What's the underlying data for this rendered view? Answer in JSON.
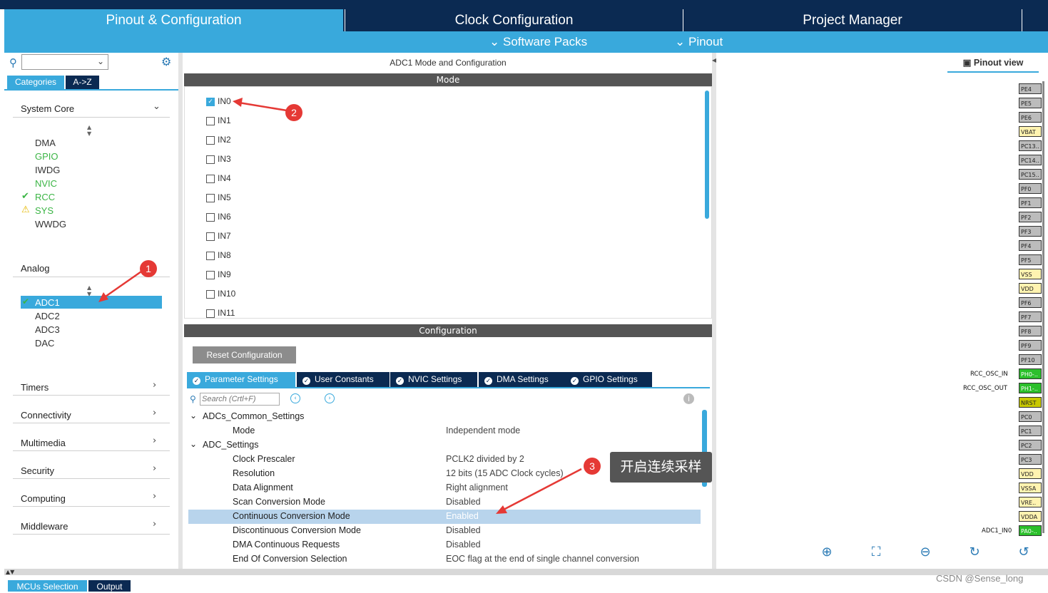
{
  "tabs": [
    {
      "label": "Pinout & Configuration"
    },
    {
      "label": "Clock Configuration"
    },
    {
      "label": "Project Manager"
    }
  ],
  "subbar": {
    "software_packs": "Software Packs",
    "pinout": "Pinout"
  },
  "left": {
    "tab_categories": "Categories",
    "tab_az": "A->Z",
    "system_core": "System Core",
    "system_core_items": [
      "DMA",
      "GPIO",
      "IWDG",
      "NVIC",
      "RCC",
      "SYS",
      "WWDG"
    ],
    "analog": "Analog",
    "analog_items": [
      "ADC1",
      "ADC2",
      "ADC3",
      "DAC"
    ],
    "categories": [
      "Timers",
      "Connectivity",
      "Multimedia",
      "Security",
      "Computing",
      "Middleware"
    ]
  },
  "center": {
    "title": "ADC1 Mode and Configuration",
    "mode_header": "Mode",
    "channels": [
      "IN0",
      "IN1",
      "IN2",
      "IN3",
      "IN4",
      "IN5",
      "IN6",
      "IN7",
      "IN8",
      "IN9",
      "IN10",
      "IN11"
    ],
    "config_header": "Configuration",
    "reset_button": "Reset Configuration",
    "param_tabs": [
      "Parameter Settings",
      "User Constants",
      "NVIC Settings",
      "DMA Settings",
      "GPIO Settings"
    ],
    "search_placeholder": "Search (Crtl+F)",
    "groups": {
      "common": "ADCs_Common_Settings",
      "adc": "ADC_Settings"
    },
    "params": [
      {
        "name": "Mode",
        "value": "Independent mode"
      },
      {
        "name": "Clock Prescaler",
        "value": "PCLK2 divided by 2"
      },
      {
        "name": "Resolution",
        "value": "12 bits (15 ADC Clock cycles)"
      },
      {
        "name": "Data Alignment",
        "value": "Right alignment"
      },
      {
        "name": "Scan Conversion Mode",
        "value": "Disabled"
      },
      {
        "name": "Continuous Conversion Mode",
        "value": "Enabled"
      },
      {
        "name": "Discontinuous Conversion Mode",
        "value": "Disabled"
      },
      {
        "name": "DMA Continuous Requests",
        "value": "Disabled"
      },
      {
        "name": "End Of Conversion Selection",
        "value": "EOC flag at the end of single channel conversion"
      }
    ]
  },
  "right": {
    "pinout_view": "Pinout view",
    "pins": [
      "PE4",
      "PE5",
      "PE6",
      "VBAT",
      "PC13..",
      "PC14..",
      "PC15..",
      "PF0",
      "PF1",
      "PF2",
      "PF3",
      "PF4",
      "PF5",
      "VSS",
      "VDD",
      "PF6",
      "PF7",
      "PF8",
      "PF9",
      "PF10",
      "PH0-..",
      "PH1-..",
      "NRST",
      "PC0",
      "PC1",
      "PC2",
      "PC3",
      "VDD",
      "VSSA",
      "VRE..",
      "VDDA",
      "PA0-.."
    ],
    "pin_label_osc_in": "RCC_OSC_IN",
    "pin_label_osc_out": "RCC_OSC_OUT",
    "pin_label_adc": "ADC1_IN0"
  },
  "annotations": {
    "one": "1",
    "two": "2",
    "three": "3",
    "note": "开启连续采样"
  },
  "bottom": {
    "mcus_selection": "MCUs Selection",
    "output": "Output",
    "watermark": "CSDN @Sense_long"
  }
}
